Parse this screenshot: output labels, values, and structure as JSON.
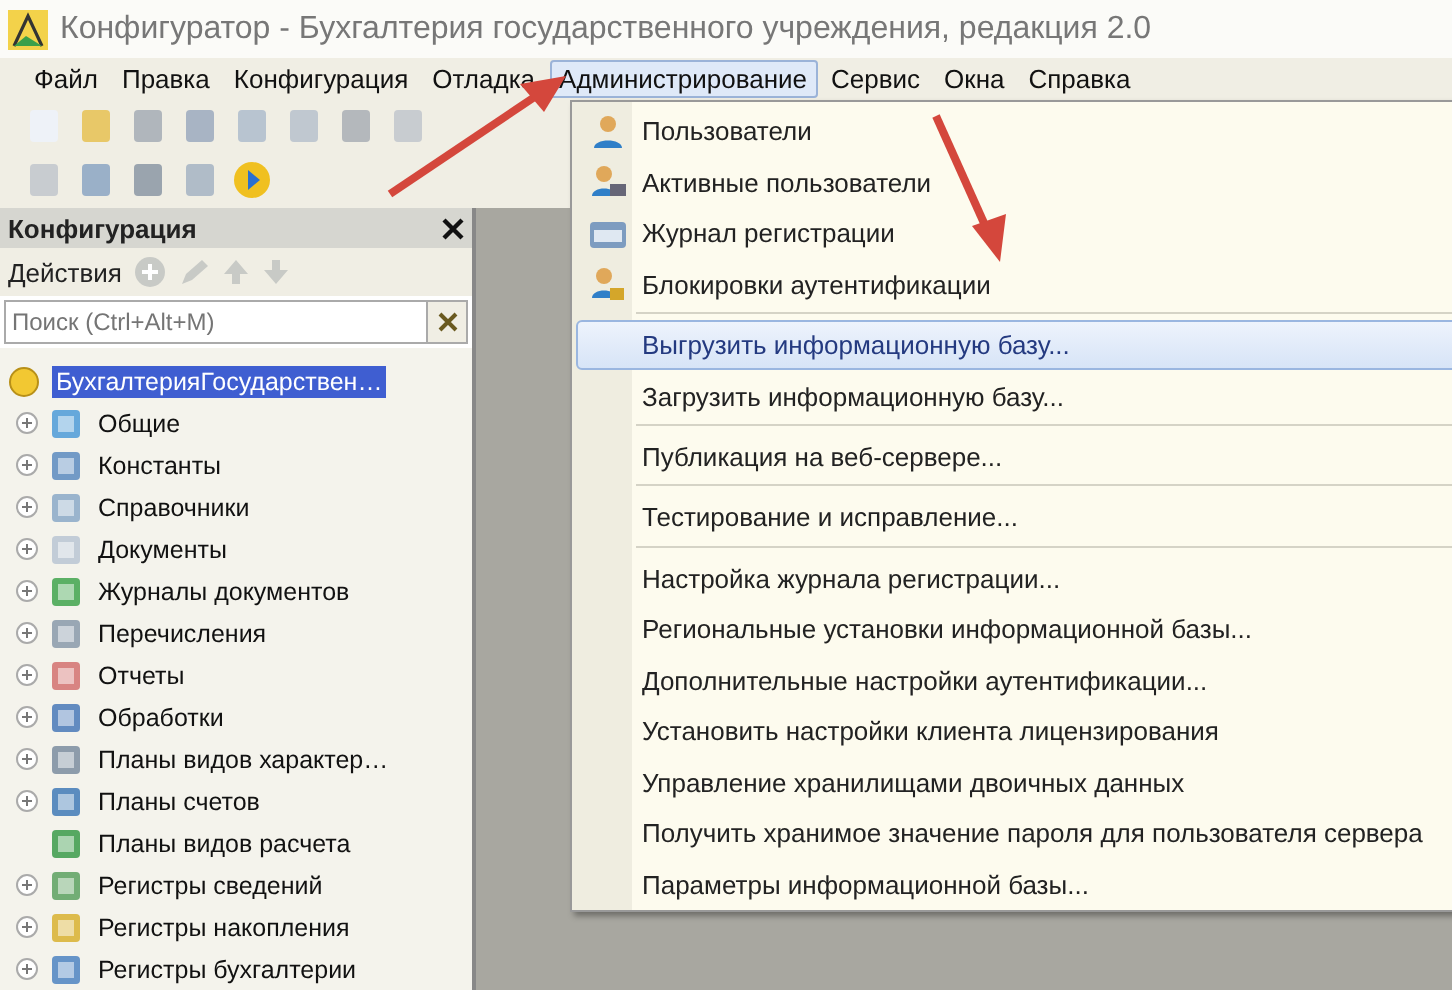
{
  "window": {
    "title": "Конфигуратор - Бухгалтерия государственного учреждения, редакция 2.0"
  },
  "menu_bar": [
    {
      "label": "Файл",
      "selected": false
    },
    {
      "label": "Правка",
      "selected": false
    },
    {
      "label": "Конфигурация",
      "selected": false
    },
    {
      "label": "Отладка",
      "selected": false
    },
    {
      "label": "Администрирование",
      "selected": true
    },
    {
      "label": "Сервис",
      "selected": false
    },
    {
      "label": "Окна",
      "selected": false
    },
    {
      "label": "Справка",
      "selected": false
    }
  ],
  "config_panel": {
    "title": "Конфигурация",
    "actions_label": "Действия",
    "search": {
      "placeholder": "Поиск (Ctrl+Alt+M)"
    },
    "root": {
      "label": "БухгалтерияГосударствен…",
      "selected": true
    },
    "tree": [
      {
        "label": "Общие",
        "kind": "common",
        "expandable": true
      },
      {
        "label": "Константы",
        "kind": "constants",
        "expandable": true
      },
      {
        "label": "Справочники",
        "kind": "catalogs",
        "expandable": true
      },
      {
        "label": "Документы",
        "kind": "documents",
        "expandable": true
      },
      {
        "label": "Журналы документов",
        "kind": "journals",
        "expandable": true
      },
      {
        "label": "Перечисления",
        "kind": "enums",
        "expandable": true
      },
      {
        "label": "Отчеты",
        "kind": "reports",
        "expandable": true
      },
      {
        "label": "Обработки",
        "kind": "processors",
        "expandable": true
      },
      {
        "label": "Планы видов характер…",
        "kind": "characteristics",
        "expandable": true
      },
      {
        "label": "Планы счетов",
        "kind": "accounts",
        "expandable": true
      },
      {
        "label": "Планы видов расчета",
        "kind": "calculation",
        "expandable": false
      },
      {
        "label": "Регистры сведений",
        "kind": "info",
        "expandable": true
      },
      {
        "label": "Регистры накопления",
        "kind": "accumulation",
        "expandable": true
      },
      {
        "label": "Регистры бухгалтерии",
        "kind": "accounting",
        "expandable": true
      }
    ]
  },
  "dropdown_menu": [
    {
      "kind": "user",
      "label": "Пользователи",
      "selected": false
    },
    {
      "kind": "users",
      "label": "Активные пользователи",
      "selected": false
    },
    {
      "kind": "log",
      "label": "Журнал регистрации",
      "selected": false
    },
    {
      "kind": "lock",
      "label": "Блокировки аутентификации",
      "selected": false
    },
    {
      "kind": "separator"
    },
    {
      "kind": "plain",
      "label": "Выгрузить информационную базу...",
      "selected": true
    },
    {
      "kind": "plain",
      "label": "Загрузить информационную базу...",
      "selected": false
    },
    {
      "kind": "separator"
    },
    {
      "kind": "plain",
      "label": "Публикация на веб-сервере...",
      "selected": false
    },
    {
      "kind": "separator"
    },
    {
      "kind": "plain",
      "label": "Тестирование и исправление...",
      "selected": false
    },
    {
      "kind": "separator"
    },
    {
      "kind": "plain",
      "label": "Настройка журнала регистрации...",
      "selected": false
    },
    {
      "kind": "plain",
      "label": "Региональные установки информационной базы...",
      "selected": false
    },
    {
      "kind": "plain",
      "label": "Дополнительные настройки аутентификации...",
      "selected": false
    },
    {
      "kind": "plain",
      "label": "Установить настройки клиента лицензирования",
      "selected": false
    },
    {
      "kind": "plain",
      "label": "Управление хранилищами двоичных данных",
      "selected": false
    },
    {
      "kind": "plain",
      "label": "Получить хранимое значение пароля для пользователя сервера",
      "selected": false
    },
    {
      "kind": "plain",
      "label": "Параметры информационной базы...",
      "selected": false
    }
  ]
}
